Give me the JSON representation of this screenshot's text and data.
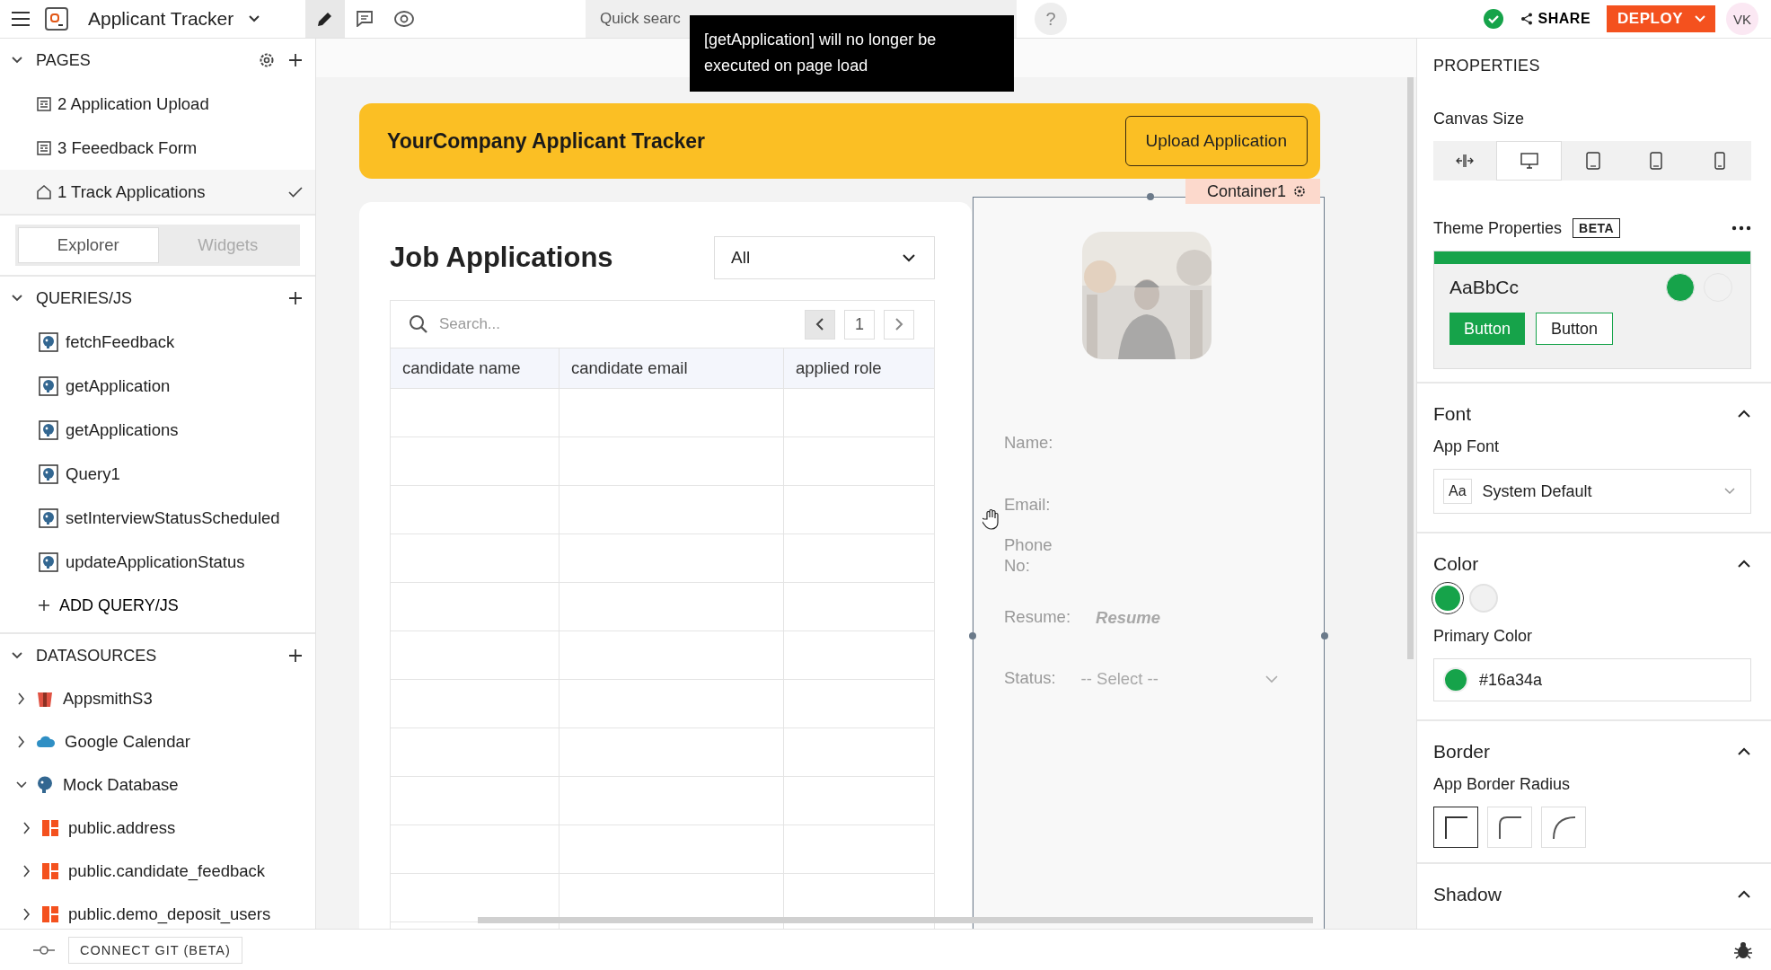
{
  "topbar": {
    "app_name": "Applicant Tracker",
    "modes": [
      {
        "kind": "edit",
        "selected": true
      },
      {
        "kind": "comment",
        "selected": false
      },
      {
        "kind": "view",
        "selected": false
      }
    ],
    "search_placeholder": "Quick searc",
    "help": "?",
    "share": "SHARE",
    "deploy": "DEPLOY",
    "user_initials": "VK"
  },
  "tooltip": "[getApplication] will no longer be executed on page load",
  "sidebar": {
    "pages_title": "PAGES",
    "pages": [
      {
        "name": "2 Application Upload",
        "kind": "page",
        "selected": false
      },
      {
        "name": "3 Feeedback Form",
        "kind": "page",
        "selected": false
      },
      {
        "name": "1 Track Applications",
        "kind": "home",
        "selected": true
      }
    ],
    "tabs": [
      {
        "label": "Explorer",
        "selected": true
      },
      {
        "label": "Widgets",
        "selected": false
      }
    ],
    "queries_title": "QUERIES/JS",
    "queries": [
      "fetchFeedback",
      "getApplication",
      "getApplications",
      "Query1",
      "setInterviewStatusScheduled",
      "updateApplicationStatus"
    ],
    "add_query": "ADD QUERY/JS",
    "datasources_title": "DATASOURCES",
    "datasources": [
      {
        "name": "AppsmithS3",
        "kind": "s3",
        "expanded": false
      },
      {
        "name": "Google Calendar",
        "kind": "cloud",
        "expanded": false
      },
      {
        "name": "Mock Database",
        "kind": "postgres",
        "expanded": true,
        "children": [
          {
            "name": "public.address"
          },
          {
            "name": "public.candidate_feedback"
          },
          {
            "name": "public.demo_deposit_users"
          }
        ]
      }
    ]
  },
  "canvas": {
    "header_title": "YourCompany Applicant Tracker",
    "upload_button": "Upload Application",
    "container_label": "Container1",
    "list_title": "Job Applications",
    "filter_value": "All",
    "table_search_placeholder": "Search...",
    "page_number": "1",
    "table": {
      "columns": [
        "candidate name",
        "candidate email",
        "applied role"
      ]
    },
    "form": {
      "name_label": "Name:",
      "email_label": "Email:",
      "phone_label": "Phone No:",
      "resume_label": "Resume:",
      "resume_value": "Resume",
      "status_label": "Status:",
      "status_placeholder": "-- Select --"
    }
  },
  "properties": {
    "title": "PROPERTIES",
    "canvas_size_label": "Canvas Size",
    "canvas_sizes": [
      {
        "kind": "fluid",
        "selected": false
      },
      {
        "kind": "desktop",
        "selected": true
      },
      {
        "kind": "tablet-landscape",
        "selected": false
      },
      {
        "kind": "tablet",
        "selected": false
      },
      {
        "kind": "mobile",
        "selected": false
      }
    ],
    "theme_label": "Theme Properties",
    "theme_badge": "BETA",
    "preview_text": "AaBbCc",
    "preview_colors": [
      {
        "color": "#16a34a"
      },
      {
        "color": "#f1f1f1"
      }
    ],
    "preview_buttons": [
      "Button",
      "Button"
    ],
    "font_title": "Font",
    "app_font_label": "App Font",
    "font_icon_text": "Aa",
    "font_value": "System Default",
    "color_title": "Color",
    "color_swatches": [
      {
        "color": "#16a34a",
        "selected": true
      },
      {
        "color": "#f1f1f1",
        "selected": false
      }
    ],
    "primary_color_label": "Primary Color",
    "primary_color_value": "#16a34a",
    "border_title": "Border",
    "border_radius_label": "App Border Radius",
    "border_radius_options": [
      {
        "kind": "none",
        "selected": true
      },
      {
        "kind": "medium",
        "selected": false
      },
      {
        "kind": "large",
        "selected": false
      }
    ],
    "shadow_title": "Shadow"
  },
  "bottom_bar": {
    "git_button": "CONNECT GIT (BETA)"
  }
}
